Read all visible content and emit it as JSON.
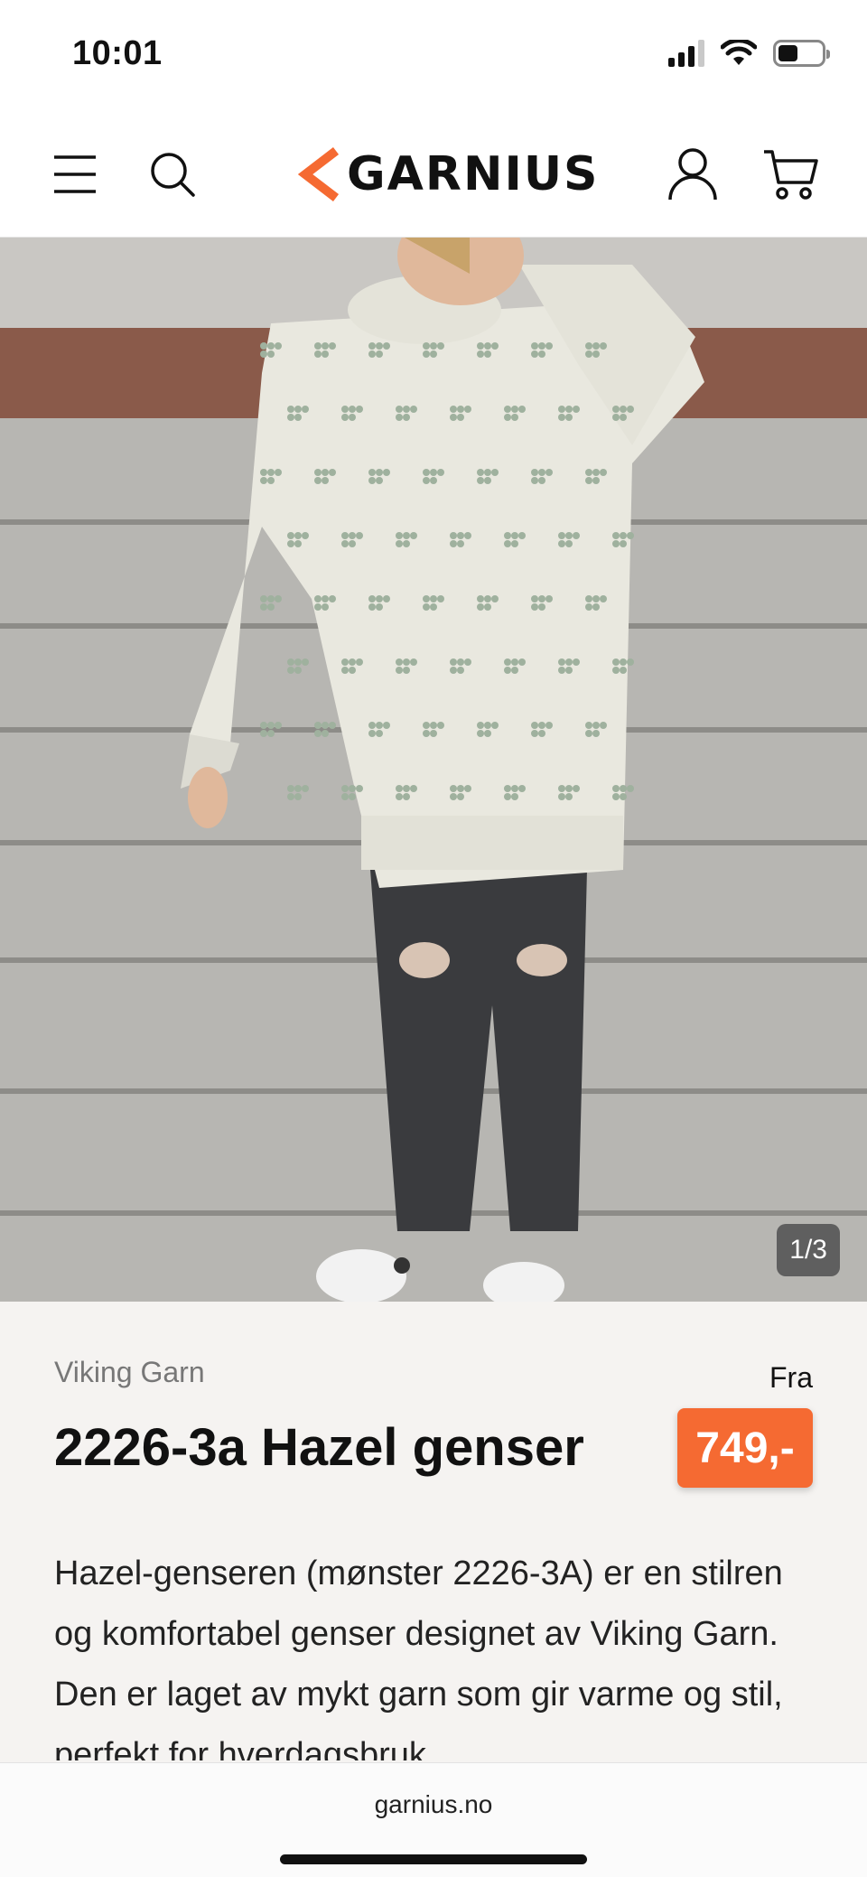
{
  "status_bar": {
    "time": "10:01",
    "battery_level": 0.45
  },
  "header": {
    "logo_text": "GARNIUS",
    "icons": [
      "menu-icon",
      "search-icon",
      "account-icon",
      "cart-icon"
    ],
    "accent_color": "#f56a32"
  },
  "gallery": {
    "counter": "1/3",
    "current_index": 1,
    "total": 3
  },
  "product": {
    "brand": "Viking Garn",
    "title": "2226-3a Hazel genser",
    "price_prefix": "Fra",
    "price": "749,-",
    "description": "Hazel-genseren (mønster 2226-3A) er en stilren og komfortabel genser designet av Viking Garn. Den er laget av mykt garn som gir varme og stil, perfekt for hverdagsbruk."
  },
  "browser": {
    "url": "garnius.no"
  }
}
